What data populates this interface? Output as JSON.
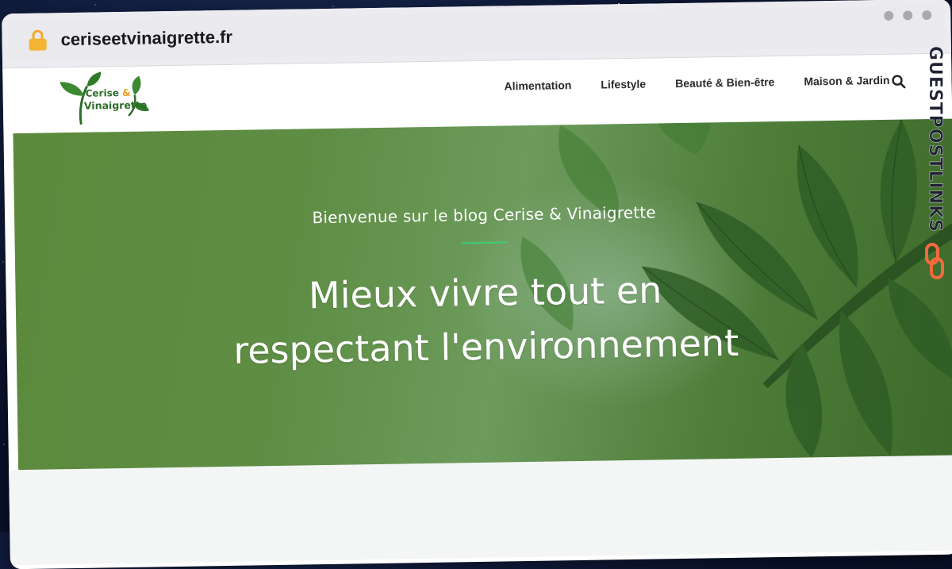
{
  "browser": {
    "url": "ceriseetvinaigrette.fr",
    "lock_icon": "lock-icon",
    "window_dots": [
      "dot",
      "dot",
      "dot"
    ]
  },
  "logo": {
    "line1": "Cerise",
    "amp": "&",
    "line2": "Vinaigrette",
    "icon": "leaf-sprout-icon"
  },
  "nav": {
    "items": [
      {
        "label": "Alimentation"
      },
      {
        "label": "Lifestyle"
      },
      {
        "label": "Beauté & Bien-être"
      },
      {
        "label": "Maison & Jardin"
      }
    ],
    "search_icon": "search-icon"
  },
  "hero": {
    "subtitle": "Bienvenue sur le blog Cerise & Vinaigrette",
    "title_line1": "Mieux vivre tout en",
    "title_line2": "respectant l'environnement",
    "accent_color": "#3ecb7a"
  },
  "watermark": {
    "text": "GUESTPOSTLINKS",
    "icon": "chain-link-icon",
    "icon_color": "#f26a3d"
  },
  "colors": {
    "brand_green": "#2c6e2a",
    "brand_orange": "#f0a31c",
    "nav_text": "#2b2b2b"
  }
}
